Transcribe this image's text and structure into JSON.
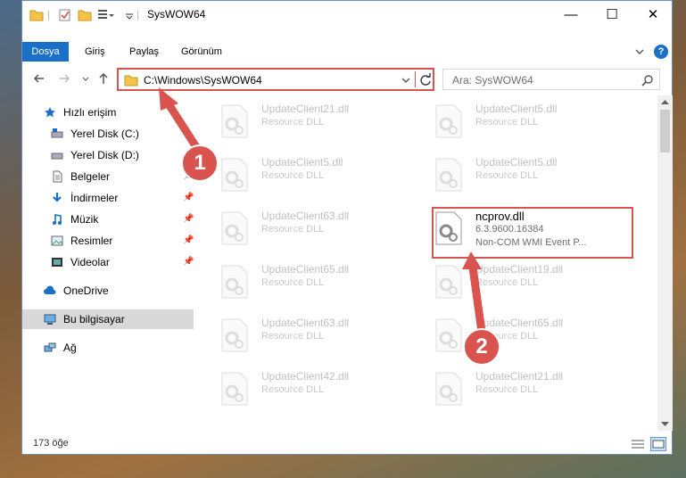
{
  "titlebar": {
    "title": "SysWOW64",
    "minimize_label": "—",
    "maximize_label": "☐",
    "close_label": "✕"
  },
  "ribbon": {
    "tabs": [
      "Dosya",
      "Giriş",
      "Paylaş",
      "Görünüm"
    ],
    "help_label": "?"
  },
  "navbar": {
    "address": "C:\\Windows\\SysWOW64",
    "search_placeholder": "Ara: SysWOW64"
  },
  "sidebar": {
    "quick_access": "Hızlı erişim",
    "items": [
      {
        "label": "Yerel Disk (C:)",
        "pinned": false
      },
      {
        "label": "Yerel Disk (D:)",
        "pinned": false
      },
      {
        "label": "Belgeler",
        "pinned": true
      },
      {
        "label": "İndirmeler",
        "pinned": true
      },
      {
        "label": "Müzik",
        "pinned": true
      },
      {
        "label": "Resimler",
        "pinned": true
      },
      {
        "label": "Videolar",
        "pinned": true
      }
    ],
    "onedrive": "OneDrive",
    "this_pc": "Bu bilgisayar",
    "network": "Ağ"
  },
  "files": [
    {
      "name": "UpdateClient21.dll",
      "desc": "Resource DLL"
    },
    {
      "name": "UpdateClient5.dll",
      "desc": "Resource DLL"
    },
    {
      "name": "UpdateClient5.dll",
      "desc": "Resource DLL"
    },
    {
      "name": "UpdateClient5.dll",
      "desc": "Resource DLL"
    },
    {
      "name": "UpdateClient63.dll",
      "desc": "Resource DLL"
    },
    {
      "name": "ncprov.dll",
      "desc": "6.3.9600.16384",
      "desc2": "Non-COM WMI Event P..."
    },
    {
      "name": "UpdateClient65.dll",
      "desc": "Resource DLL"
    },
    {
      "name": "UpdateClient19.dll",
      "desc": "Resource DLL"
    },
    {
      "name": "UpdateClient63.dll",
      "desc": "Resource DLL"
    },
    {
      "name": "UpdateClient65.dll",
      "desc": "Resource DLL"
    },
    {
      "name": "UpdateClient42.dll",
      "desc": "Resource DLL"
    },
    {
      "name": "UpdateClient21.dll",
      "desc": "Resource DLL"
    }
  ],
  "status": {
    "item_count": "173 öğe"
  },
  "annotations": {
    "badge1": "1",
    "badge2": "2"
  },
  "colors": {
    "accent": "#1a6fc9",
    "annotation": "#d9534f"
  }
}
